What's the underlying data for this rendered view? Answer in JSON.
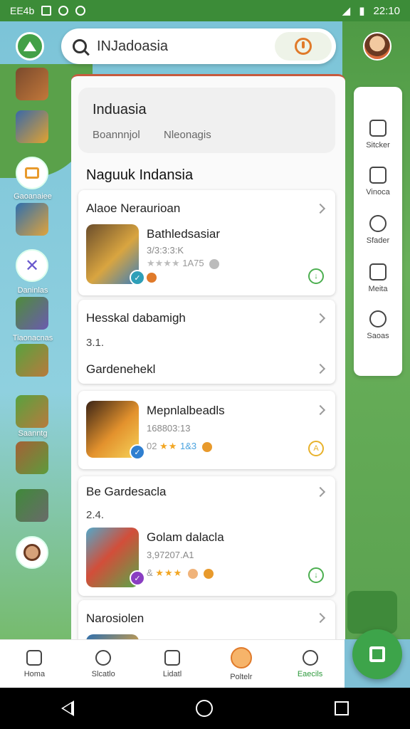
{
  "status_bar": {
    "left_text": "EE4b",
    "time": "22:10"
  },
  "search": {
    "value": "INJadoasia",
    "placeholder": ""
  },
  "rail": [
    {
      "label": ""
    },
    {
      "label": ""
    },
    {
      "label": "Gaoanaiee"
    },
    {
      "label": ""
    },
    {
      "label": "Daninlas"
    },
    {
      "label": "Tiaonacnas"
    },
    {
      "label": ""
    },
    {
      "label": "Saanntg"
    },
    {
      "label": ""
    },
    {
      "label": ""
    },
    {
      "label": ""
    }
  ],
  "side_panel": [
    {
      "label": "Sitcker"
    },
    {
      "label": "Vinoca"
    },
    {
      "label": "Sfader"
    },
    {
      "label": "Meita"
    },
    {
      "label": "Saoas"
    }
  ],
  "header": {
    "title": "Induasia",
    "sub1": "Boannnjol",
    "sub2": "Nleonagis"
  },
  "section_title": "Naguuk Indansia",
  "cards": [
    {
      "head": "Alaoe Neraurioan",
      "app_name": "Bathledsasiar",
      "app_meta": "3/3:3:3:K",
      "rating_text": "1A75"
    },
    {
      "head": "Hesskal dabamigh",
      "sub1": "3.1.",
      "sub2": "Gardenehekl"
    },
    {
      "app_name": "Mepnlalbeadls",
      "app_meta": "168803:13",
      "rating_prefix": "02",
      "rating_suffix": "1&3"
    },
    {
      "head": "Be Gardesacla",
      "sub": "2.4.",
      "app_name": "Golam dalacla",
      "app_meta": "3,97207.A1",
      "rating_prefix": "&"
    },
    {
      "head": "Narosiolen"
    }
  ],
  "bottom_nav": [
    {
      "label": "Homa"
    },
    {
      "label": "Slcatlo"
    },
    {
      "label": "Lidatl"
    },
    {
      "label": "Poltelr"
    },
    {
      "label": "Eaecils"
    }
  ],
  "colors": {
    "green": "#3da44a",
    "orange": "#e07a2a",
    "star": "#f2a623"
  }
}
